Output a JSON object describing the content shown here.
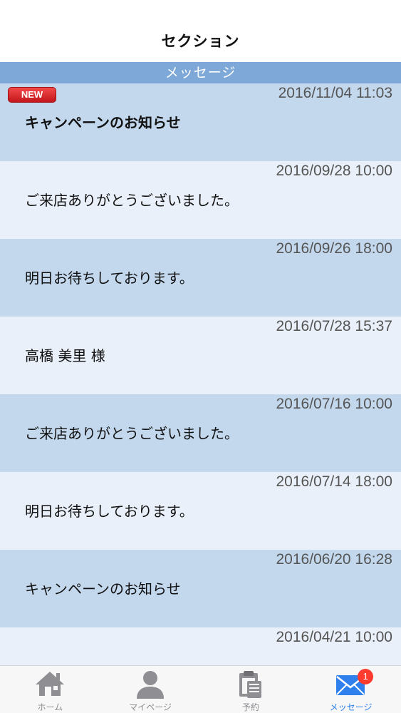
{
  "nav": {
    "title": "セクション"
  },
  "section": {
    "header": "メッセージ"
  },
  "badges": {
    "new_label": "NEW"
  },
  "messages": [
    {
      "date": "2016/11/04 11:03",
      "text": "キャンペーンのお知らせ",
      "is_new": true
    },
    {
      "date": "2016/09/28 10:00",
      "text": "ご来店ありがとうございました。"
    },
    {
      "date": "2016/09/26 18:00",
      "text": "明日お待ちしております。"
    },
    {
      "date": "2016/07/28 15:37",
      "text": "高橋 美里 様"
    },
    {
      "date": "2016/07/16 10:00",
      "text": "ご来店ありがとうございました。"
    },
    {
      "date": "2016/07/14 18:00",
      "text": "明日お待ちしております。"
    },
    {
      "date": "2016/06/20 16:28",
      "text": "キャンペーンのお知らせ"
    },
    {
      "date": "2016/04/21 10:00",
      "text": ""
    }
  ],
  "tabbar": {
    "home": {
      "label": "ホーム",
      "icon": "home-icon"
    },
    "mypage": {
      "label": "マイページ",
      "icon": "person-icon"
    },
    "reserve": {
      "label": "予約",
      "icon": "clipboard-icon"
    },
    "messages": {
      "label": "メッセージ",
      "icon": "mail-icon",
      "badge": "1",
      "active": true
    }
  },
  "colors": {
    "section_header": "#7ea8d8",
    "row_dark": "#c3d8ed",
    "row_light": "#e9f0f9",
    "active_tab": "#2f80ed",
    "badge": "#ff3b30",
    "new_badge": "#d9221f"
  }
}
